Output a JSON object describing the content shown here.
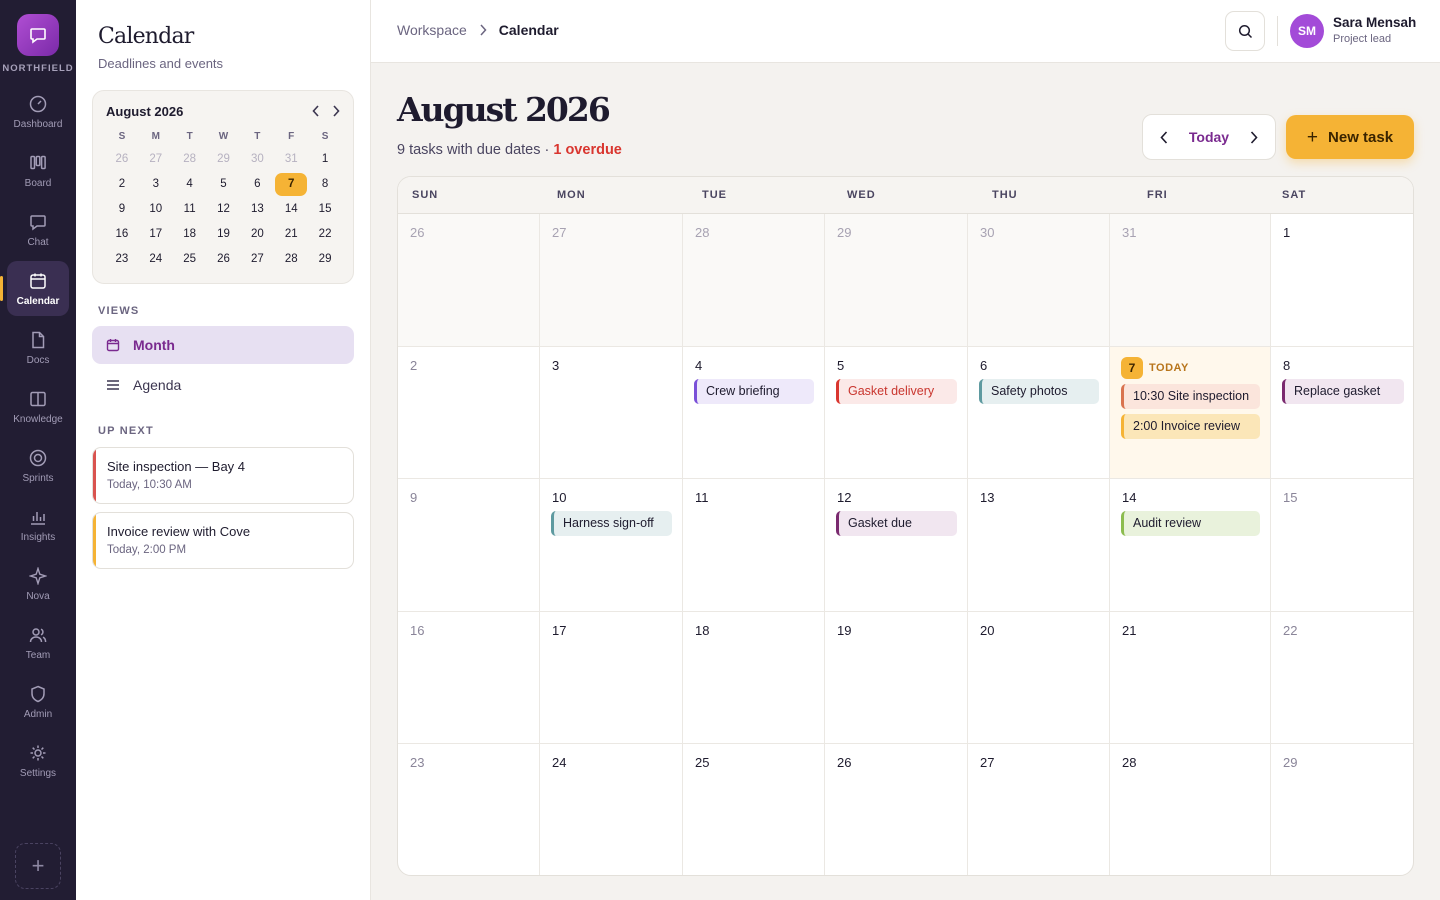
{
  "rail": {
    "brand": "NORTHFIELD",
    "items": [
      {
        "label": "Dashboard",
        "icon": "dashboard-icon"
      },
      {
        "label": "Board",
        "icon": "board-icon"
      },
      {
        "label": "Chat",
        "icon": "chat-icon"
      },
      {
        "label": "Calendar",
        "icon": "calendar-icon",
        "active": true
      },
      {
        "label": "Docs",
        "icon": "docs-icon"
      },
      {
        "label": "Knowledge",
        "icon": "knowledge-icon"
      },
      {
        "label": "Sprints",
        "icon": "sprints-icon"
      },
      {
        "label": "Insights",
        "icon": "insights-icon"
      },
      {
        "label": "Nova",
        "icon": "nova-icon"
      },
      {
        "label": "Team",
        "icon": "team-icon"
      },
      {
        "label": "Admin",
        "icon": "admin-icon"
      },
      {
        "label": "Settings",
        "icon": "settings-icon"
      }
    ],
    "add_label": "+"
  },
  "sidebar": {
    "title": "Calendar",
    "subtitle": "Deadlines and events",
    "mini_calendar": {
      "month": "August 2026",
      "weekdays": [
        "S",
        "M",
        "T",
        "W",
        "T",
        "F",
        "S"
      ],
      "days": [
        {
          "d": "26",
          "out": true
        },
        {
          "d": "27",
          "out": true
        },
        {
          "d": "28",
          "out": true
        },
        {
          "d": "29",
          "out": true
        },
        {
          "d": "30",
          "out": true
        },
        {
          "d": "31",
          "out": true
        },
        {
          "d": "1"
        },
        {
          "d": "2"
        },
        {
          "d": "3"
        },
        {
          "d": "4"
        },
        {
          "d": "5"
        },
        {
          "d": "6"
        },
        {
          "d": "7",
          "today": true
        },
        {
          "d": "8"
        },
        {
          "d": "9"
        },
        {
          "d": "10"
        },
        {
          "d": "11"
        },
        {
          "d": "12"
        },
        {
          "d": "13"
        },
        {
          "d": "14"
        },
        {
          "d": "15"
        },
        {
          "d": "16"
        },
        {
          "d": "17"
        },
        {
          "d": "18"
        },
        {
          "d": "19"
        },
        {
          "d": "20"
        },
        {
          "d": "21"
        },
        {
          "d": "22"
        },
        {
          "d": "23"
        },
        {
          "d": "24"
        },
        {
          "d": "25"
        },
        {
          "d": "26"
        },
        {
          "d": "27"
        },
        {
          "d": "28"
        },
        {
          "d": "29"
        }
      ]
    },
    "views_label": "VIEWS",
    "views": [
      {
        "label": "Month",
        "active": true
      },
      {
        "label": "Agenda"
      }
    ],
    "up_next_label": "UP NEXT",
    "up_next": [
      {
        "title": "Site inspection — Bay 4",
        "time": "Today, 10:30 AM",
        "color": "red"
      },
      {
        "title": "Invoice review with Cove",
        "time": "Today, 2:00 PM",
        "color": "amber"
      }
    ]
  },
  "topbar": {
    "breadcrumb": [
      "Workspace",
      "Calendar"
    ],
    "user": {
      "initials": "SM",
      "name": "Sara Mensah",
      "role": "Project lead"
    }
  },
  "main": {
    "month_title": "August 2026",
    "summary": "9 tasks with due dates · ",
    "overdue": "1 overdue",
    "today_label": "Today",
    "new_task_label": "New task",
    "weekdays": [
      "SUN",
      "MON",
      "TUE",
      "WED",
      "THU",
      "FRI",
      "SAT"
    ],
    "today_word": "TODAY",
    "weeks": [
      [
        {
          "d": "26",
          "out": true
        },
        {
          "d": "27",
          "out": true
        },
        {
          "d": "28",
          "out": true
        },
        {
          "d": "29",
          "out": true
        },
        {
          "d": "30",
          "out": true
        },
        {
          "d": "31",
          "out": true
        },
        {
          "d": "1"
        }
      ],
      [
        {
          "d": "2"
        },
        {
          "d": "3"
        },
        {
          "d": "4",
          "events": [
            {
              "label": "Crew briefing",
              "color": "purple"
            }
          ]
        },
        {
          "d": "5",
          "events": [
            {
              "label": "Gasket delivery",
              "color": "red"
            }
          ]
        },
        {
          "d": "6",
          "events": [
            {
              "label": "Safety photos",
              "color": "teal"
            }
          ]
        },
        {
          "d": "7",
          "today": true,
          "events": [
            {
              "label": "10:30 Site inspection",
              "color": "orange"
            },
            {
              "label": "2:00 Invoice review",
              "color": "amber"
            }
          ]
        },
        {
          "d": "8",
          "events": [
            {
              "label": "Replace gasket",
              "color": "plum"
            }
          ]
        }
      ],
      [
        {
          "d": "9"
        },
        {
          "d": "10",
          "events": [
            {
              "label": "Harness sign-off",
              "color": "teal"
            }
          ]
        },
        {
          "d": "11"
        },
        {
          "d": "12",
          "events": [
            {
              "label": "Gasket due",
              "color": "plum"
            }
          ]
        },
        {
          "d": "13"
        },
        {
          "d": "14",
          "events": [
            {
              "label": "Audit review",
              "color": "green"
            }
          ]
        },
        {
          "d": "15"
        }
      ],
      [
        {
          "d": "16"
        },
        {
          "d": "17"
        },
        {
          "d": "18"
        },
        {
          "d": "19"
        },
        {
          "d": "20"
        },
        {
          "d": "21"
        },
        {
          "d": "22"
        }
      ],
      [
        {
          "d": "23"
        },
        {
          "d": "24"
        },
        {
          "d": "25"
        },
        {
          "d": "26"
        },
        {
          "d": "27"
        },
        {
          "d": "28"
        },
        {
          "d": "29"
        }
      ]
    ]
  },
  "colors": {
    "rail_bg": "#221d33",
    "accent_amber": "#f5b335",
    "accent_purple": "#7a2a8f",
    "overdue_red": "#d9362f"
  }
}
